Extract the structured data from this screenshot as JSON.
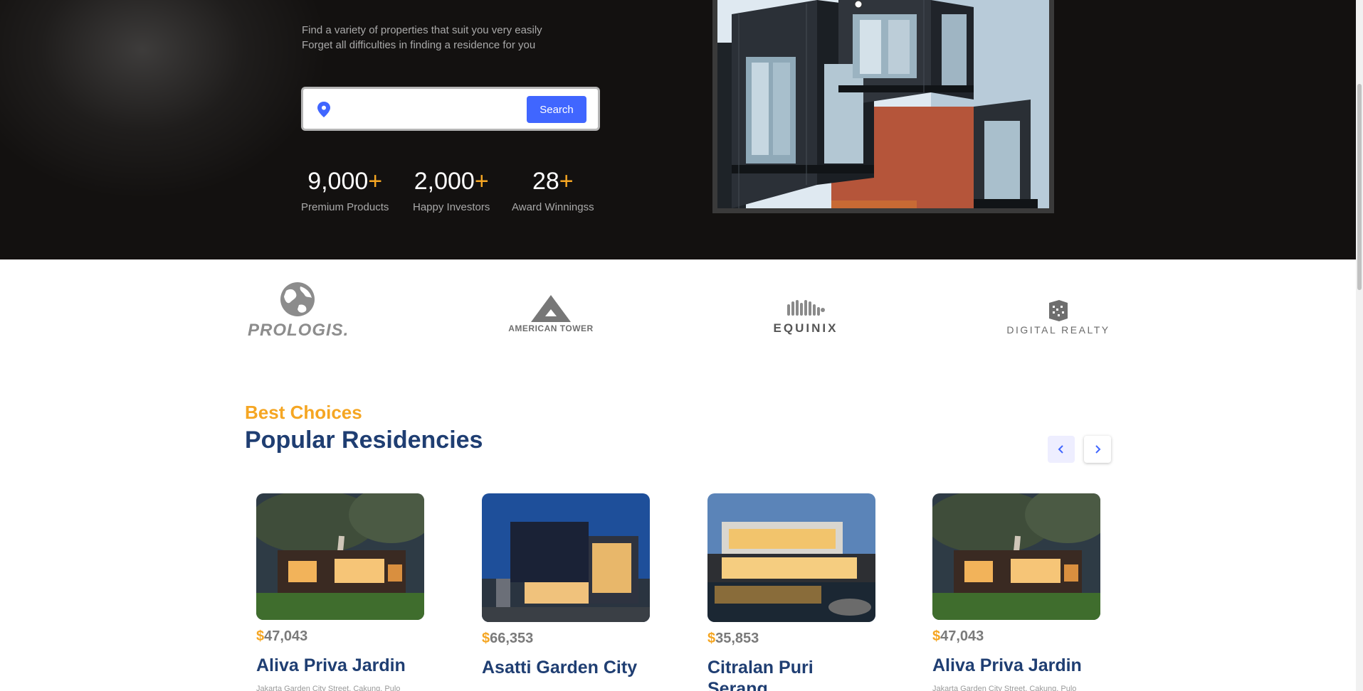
{
  "hero": {
    "description_line1": "Find a variety of properties that suit you very easily",
    "description_line2": "Forget all difficulties in finding a residence for you",
    "search": {
      "placeholder": "",
      "button_label": "Search"
    },
    "stats": [
      {
        "value": "9,000",
        "suffix": "+",
        "label": "Premium Products"
      },
      {
        "value": "2,000",
        "suffix": "+",
        "label": "Happy Investors"
      },
      {
        "value": "28",
        "suffix": "+",
        "label": "Award Winningss"
      }
    ]
  },
  "companies": [
    {
      "name": "PROLOGIS.",
      "icon": "globe-icon"
    },
    {
      "name": "AMERICAN TOWER",
      "icon": "tower-icon"
    },
    {
      "name": "EQUINIX",
      "icon": "wave-icon"
    },
    {
      "name": "DIGITAL REALTY",
      "icon": "cube-icon"
    }
  ],
  "residencies": {
    "kicker": "Best Choices",
    "title": "Popular Residencies",
    "items": [
      {
        "currency": "$",
        "price": "47,043",
        "name": "Aliva Priva Jardin",
        "address": "Jakarta Garden City Street, Cakung. Pulo"
      },
      {
        "currency": "$",
        "price": "66,353",
        "name": "Asatti Garden City",
        "address": ""
      },
      {
        "currency": "$",
        "price": "35,853",
        "name": "Citralan Puri Serang",
        "address": ""
      },
      {
        "currency": "$",
        "price": "47,043",
        "name": "Aliva Priva Jardin",
        "address": "Jakarta Garden City Street, Cakung. Pulo"
      }
    ]
  },
  "colors": {
    "hero_bg": "#131110",
    "accent_orange": "#f5a623",
    "primary_blue": "#4066ff",
    "title_navy": "#1f3e72"
  }
}
